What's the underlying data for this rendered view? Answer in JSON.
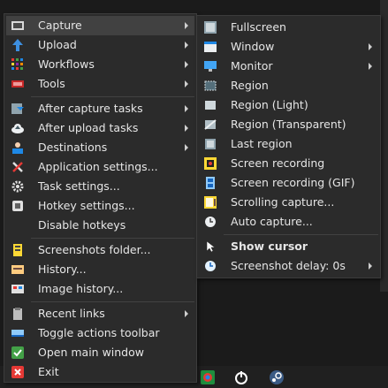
{
  "main_menu": {
    "items": [
      {
        "label": "Capture",
        "icon": "capture-icon",
        "submenu": true
      },
      {
        "label": "Upload",
        "icon": "upload-arrow-icon",
        "submenu": true
      },
      {
        "label": "Workflows",
        "icon": "workflows-grid-icon",
        "submenu": true
      },
      {
        "label": "Tools",
        "icon": "tools-icon",
        "submenu": true
      },
      {
        "label": "After capture tasks",
        "icon": "after-capture-icon",
        "submenu": true
      },
      {
        "label": "After upload tasks",
        "icon": "cloud-upload-icon",
        "submenu": true
      },
      {
        "label": "Destinations",
        "icon": "destinations-icon",
        "submenu": true
      },
      {
        "label": "Application settings...",
        "icon": "wrench-icon",
        "submenu": false
      },
      {
        "label": "Task settings...",
        "icon": "gear-icon",
        "submenu": false
      },
      {
        "label": "Hotkey settings...",
        "icon": "keyboard-icon",
        "submenu": false
      },
      {
        "label": "Disable hotkeys",
        "icon": "",
        "submenu": false
      },
      {
        "label": "Screenshots folder...",
        "icon": "folder-icon",
        "submenu": false
      },
      {
        "label": "History...",
        "icon": "history-icon",
        "submenu": false
      },
      {
        "label": "Image history...",
        "icon": "image-history-icon",
        "submenu": false
      },
      {
        "label": "Recent links",
        "icon": "clipboard-icon",
        "submenu": true
      },
      {
        "label": "Toggle actions toolbar",
        "icon": "toolbar-icon",
        "submenu": false
      },
      {
        "label": "Open main window",
        "icon": "checkmark-icon",
        "submenu": false
      },
      {
        "label": "Exit",
        "icon": "exit-icon",
        "submenu": false
      }
    ]
  },
  "capture_submenu": {
    "items": [
      {
        "label": "Fullscreen",
        "icon": "fullscreen-icon",
        "submenu": false
      },
      {
        "label": "Window",
        "icon": "window-icon",
        "submenu": true
      },
      {
        "label": "Monitor",
        "icon": "monitor-icon",
        "submenu": true
      },
      {
        "label": "Region",
        "icon": "region-icon",
        "submenu": false
      },
      {
        "label": "Region (Light)",
        "icon": "region-light-icon",
        "submenu": false
      },
      {
        "label": "Region (Transparent)",
        "icon": "region-transparent-icon",
        "submenu": false
      },
      {
        "label": "Last region",
        "icon": "last-region-icon",
        "submenu": false
      },
      {
        "label": "Screen recording",
        "icon": "screen-recording-icon",
        "submenu": false
      },
      {
        "label": "Screen recording (GIF)",
        "icon": "gif-recording-icon",
        "submenu": false
      },
      {
        "label": "Scrolling capture...",
        "icon": "scrolling-capture-icon",
        "submenu": false
      },
      {
        "label": "Auto capture...",
        "icon": "clock-icon",
        "submenu": false
      },
      {
        "label": "Show cursor",
        "icon": "cursor-icon",
        "submenu": false
      },
      {
        "label": "Screenshot delay: 0s",
        "icon": "delay-clock-icon",
        "submenu": true
      }
    ]
  },
  "colors": {
    "menu_bg": "#2b2b2b",
    "highlight": "#414141",
    "text": "#e6e6e6",
    "separator": "#424242"
  }
}
